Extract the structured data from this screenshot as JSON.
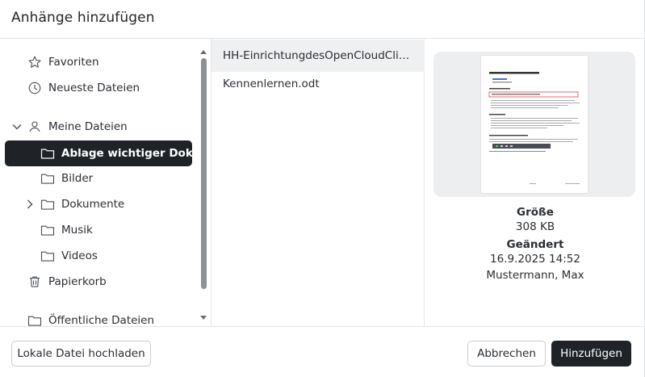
{
  "dialog": {
    "title": "Anhänge hinzufügen"
  },
  "sidebar": {
    "favorites": "Favoriten",
    "recent": "Neueste Dateien",
    "my_files": "Meine Dateien",
    "folders": [
      {
        "label": "Ablage wichtiger Doku...",
        "active": true
      },
      {
        "label": "Bilder"
      },
      {
        "label": "Dokumente"
      },
      {
        "label": "Musik"
      },
      {
        "label": "Videos"
      }
    ],
    "trash": "Papierkorb",
    "public_files": "Öffentliche Dateien"
  },
  "files": [
    {
      "name": "HH-EinrichtungdesOpenCloudClient..."
    },
    {
      "name": "Kennenlernen.odt"
    }
  ],
  "preview": {
    "size_label": "Größe",
    "size_value": "308 KB",
    "modified_label": "Geändert",
    "modified_value": "16.9.2025 14:52",
    "modified_by": "Mustermann, Max"
  },
  "footer": {
    "upload_label": "Lokale Datei hochladen",
    "cancel_label": "Abbrechen",
    "add_label": "Hinzufügen"
  },
  "colors": {
    "accent": "#1f2328",
    "selection": "#eef0f2",
    "thumb_bg": "#edeef0"
  },
  "icons": [
    "star-icon",
    "clock-icon",
    "chevron-down-icon",
    "user-icon",
    "folder-icon",
    "chevron-right-icon",
    "trash-icon"
  ]
}
